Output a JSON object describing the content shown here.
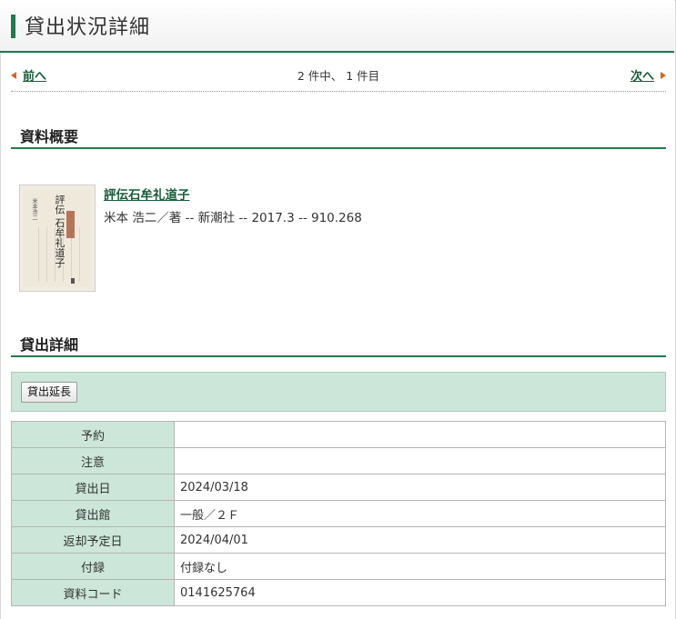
{
  "header": {
    "title": "貸出状況詳細"
  },
  "pager": {
    "prev_label": "前へ",
    "count_text": "2 件中、 1 件目",
    "next_label": "次へ"
  },
  "overview": {
    "heading": "資料概要",
    "book": {
      "title": "評伝石牟礼道子",
      "meta": "米本 浩二／著 -- 新潮社 -- 2017.3 -- 910.268",
      "cover_title": "評伝 石牟礼道子",
      "cover_author": "米本浩二"
    }
  },
  "loan": {
    "heading": "貸出詳細",
    "extend_button": "貸出延長",
    "rows": [
      {
        "label": "予約",
        "value": ""
      },
      {
        "label": "注意",
        "value": ""
      },
      {
        "label": "貸出日",
        "value": "2024/03/18"
      },
      {
        "label": "貸出館",
        "value": "一般／２Ｆ"
      },
      {
        "label": "返却予定日",
        "value": "2024/04/01"
      },
      {
        "label": "付録",
        "value": "付録なし"
      },
      {
        "label": "資料コード",
        "value": "0141625764"
      }
    ]
  },
  "colors": {
    "accent": "#1f7a4c",
    "link": "#1a5c3a",
    "label_bg": "#cce6d9",
    "arrow": "#d2691e"
  }
}
